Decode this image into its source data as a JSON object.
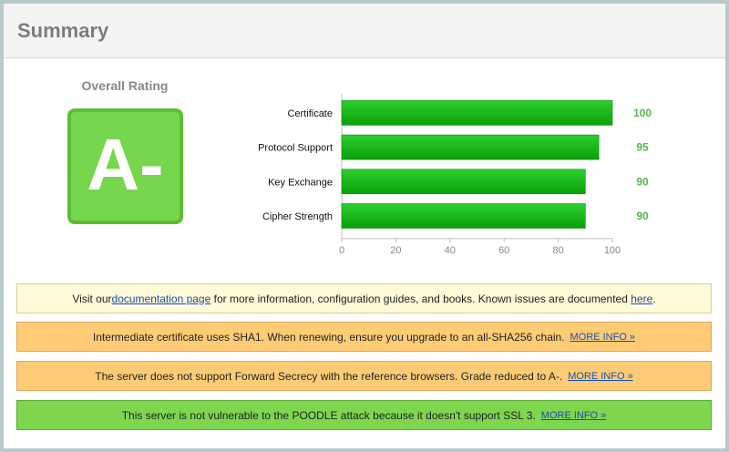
{
  "header": {
    "title": "Summary"
  },
  "rating": {
    "label": "Overall Rating",
    "grade": "A-"
  },
  "colors": {
    "grade_bg": "#76d64e",
    "bar_top": "#2ccf2c",
    "bar_bottom": "#0a9f0a",
    "score_text": "#52b84a",
    "info_bg": "#fffad8",
    "warn_bg": "#ffcc75",
    "good_bg": "#7ed64f",
    "link": "#1a4fb0"
  },
  "chart_data": {
    "type": "bar",
    "orientation": "horizontal",
    "categories": [
      "Certificate",
      "Protocol Support",
      "Key Exchange",
      "Cipher Strength"
    ],
    "values": [
      100,
      95,
      90,
      90
    ],
    "xlim": [
      0,
      100
    ],
    "ticks": [
      0,
      20,
      40,
      60,
      80,
      100
    ],
    "grid": false,
    "legend": "none"
  },
  "notices": [
    {
      "type": "info",
      "before": "Visit our ",
      "link1": "documentation page",
      "middle": " for more information, configuration guides, and books. Known issues are documented ",
      "link2": "here",
      "after": "."
    },
    {
      "type": "warn",
      "text": "Intermediate certificate uses SHA1. When renewing, ensure you upgrade to an all-SHA256 chain.",
      "more": "MORE INFO »"
    },
    {
      "type": "warn",
      "text": "The server does not support Forward Secrecy with the reference browsers. Grade reduced to A-.",
      "more": "MORE INFO »"
    },
    {
      "type": "good",
      "text": "This server is not vulnerable to the POODLE attack because it doesn't support SSL 3.",
      "more": "MORE INFO »"
    }
  ]
}
